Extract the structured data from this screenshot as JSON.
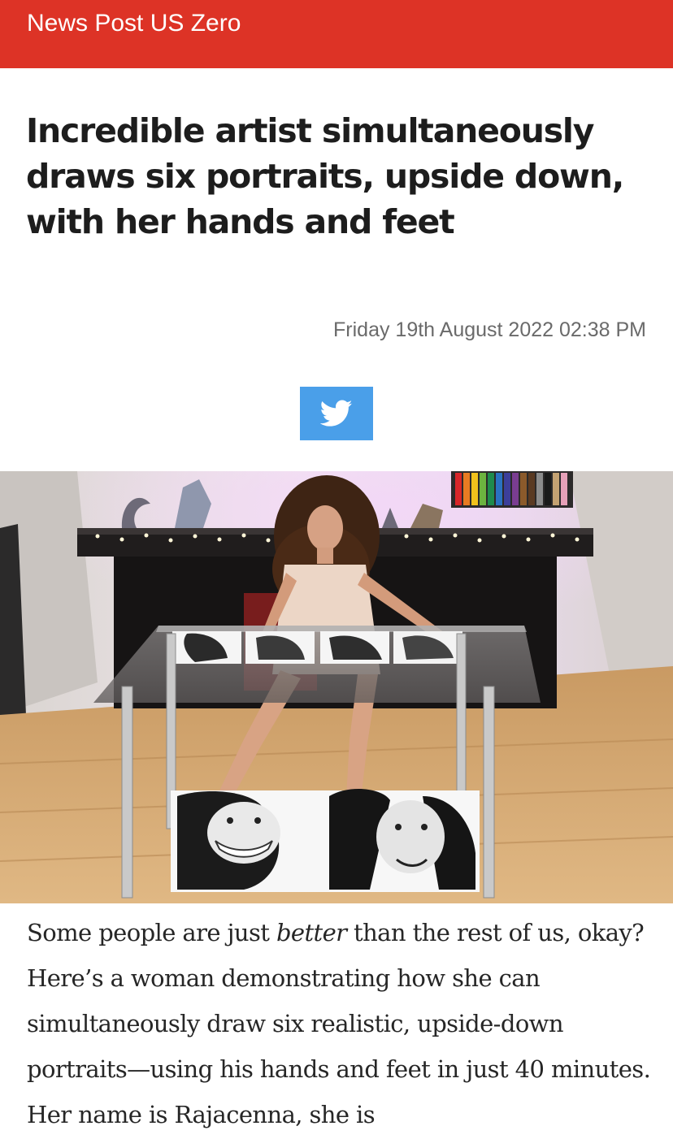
{
  "header": {
    "site_name": "News Post US Zero",
    "bar_color": "#dd3326"
  },
  "article": {
    "title": "Incredible artist simultaneously draws six portraits, upside down, with her hands and feet",
    "date": "Friday 19th August 2022 02:38 PM",
    "share": {
      "icon": "twitter-icon",
      "color": "#4a9fe9"
    },
    "image": {
      "subject": "woman-drawing-portraits-with-hands-and-feet"
    },
    "body": {
      "lead": "Some people are just ",
      "emphasis": "better",
      "rest": " than the rest of us, okay? Here’s a woman demonstrating how she can simultaneously draw six realistic, upside-down portraits—using his hands and feet in just 40 minutes. Her name is Rajacenna, she is"
    }
  }
}
